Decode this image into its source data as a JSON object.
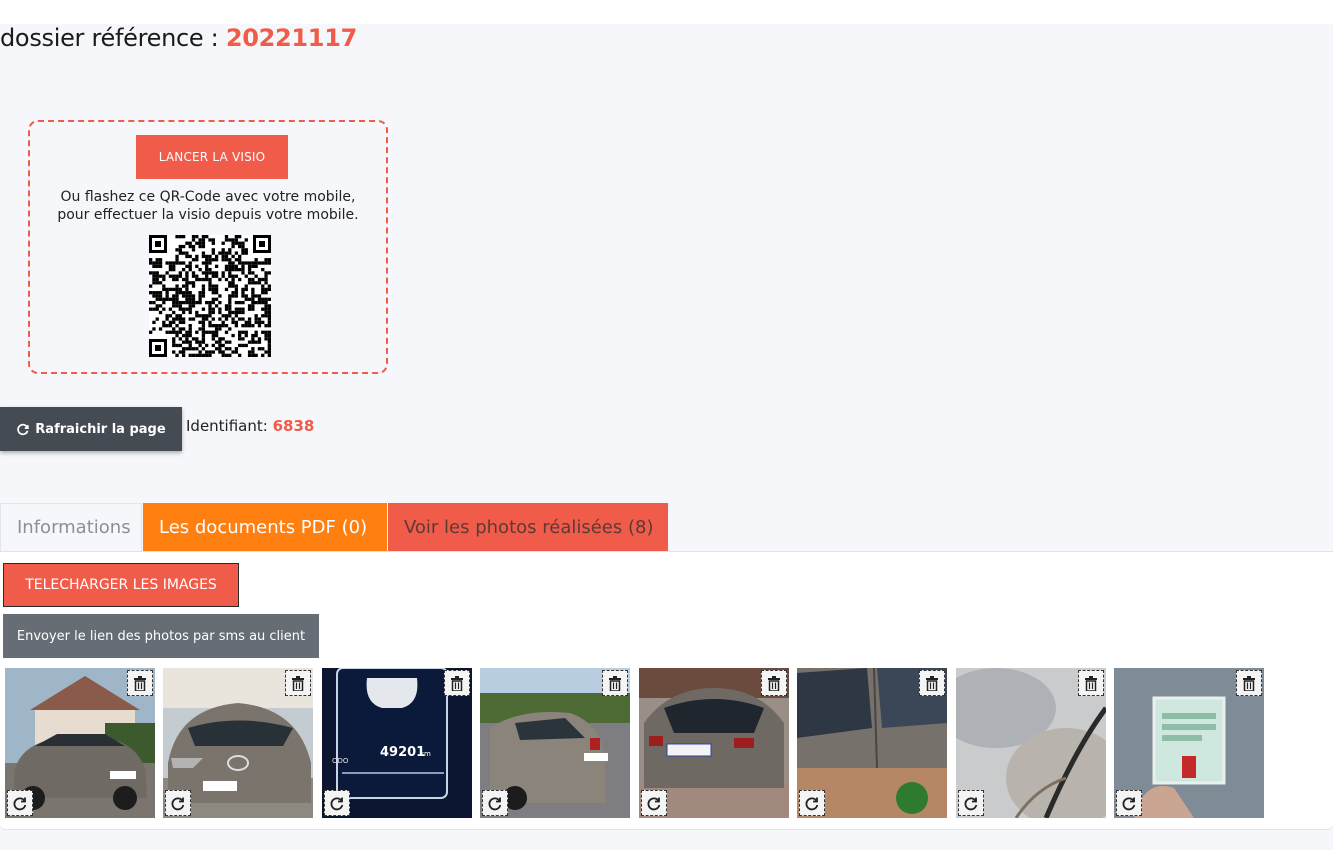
{
  "header": {
    "ref_label": "dossier référence : ",
    "ref_number": "20221117"
  },
  "visio": {
    "button_label": "LANCER LA VISIO",
    "instruction_line1": "Ou flashez ce QR-Code avec votre mobile,",
    "instruction_line2": "pour effectuer la visio depuis votre mobile."
  },
  "refresh": {
    "button_label": "Rafraichir la page",
    "identifier_label": "Identifiant: ",
    "identifier_value": "6838"
  },
  "tabs": [
    {
      "label": "Informations"
    },
    {
      "label": "Les documents PDF (0)"
    },
    {
      "label": "Voir les photos réalisées (8)"
    }
  ],
  "photos_panel": {
    "download_label": "TELECHARGER LES IMAGES",
    "sms_label": "Envoyer le lien des photos par sms au client",
    "photos": [
      {
        "subject": "car-front-left-driveway"
      },
      {
        "subject": "car-front-plate"
      },
      {
        "subject": "dashboard-odometer",
        "odometer": "49201",
        "unit": "km",
        "mode": "ODO"
      },
      {
        "subject": "car-rear-street"
      },
      {
        "subject": "car-rear-plate"
      },
      {
        "subject": "car-side-doors"
      },
      {
        "subject": "sky-windshield"
      },
      {
        "subject": "registration-document"
      }
    ]
  },
  "colors": {
    "accent": "#f15b4a",
    "orange": "#ff7f11",
    "dark_button": "#454b52",
    "grey_button": "#666d75"
  }
}
